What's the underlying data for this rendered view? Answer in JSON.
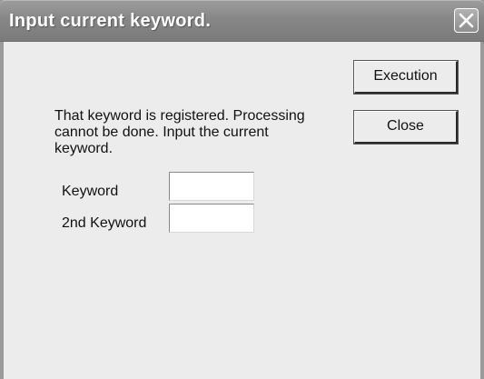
{
  "dialog": {
    "title": "Input current keyword.",
    "message": "That keyword is registered. Processing\n cannot be done. Input the current\nkeyword.",
    "buttons": {
      "execution": "Execution",
      "close": "Close"
    },
    "fields": {
      "keyword": {
        "label": "Keyword",
        "value": ""
      },
      "second_keyword": {
        "label": "2nd Keyword",
        "value": ""
      }
    },
    "icons": {
      "title_close": "close-icon"
    }
  }
}
